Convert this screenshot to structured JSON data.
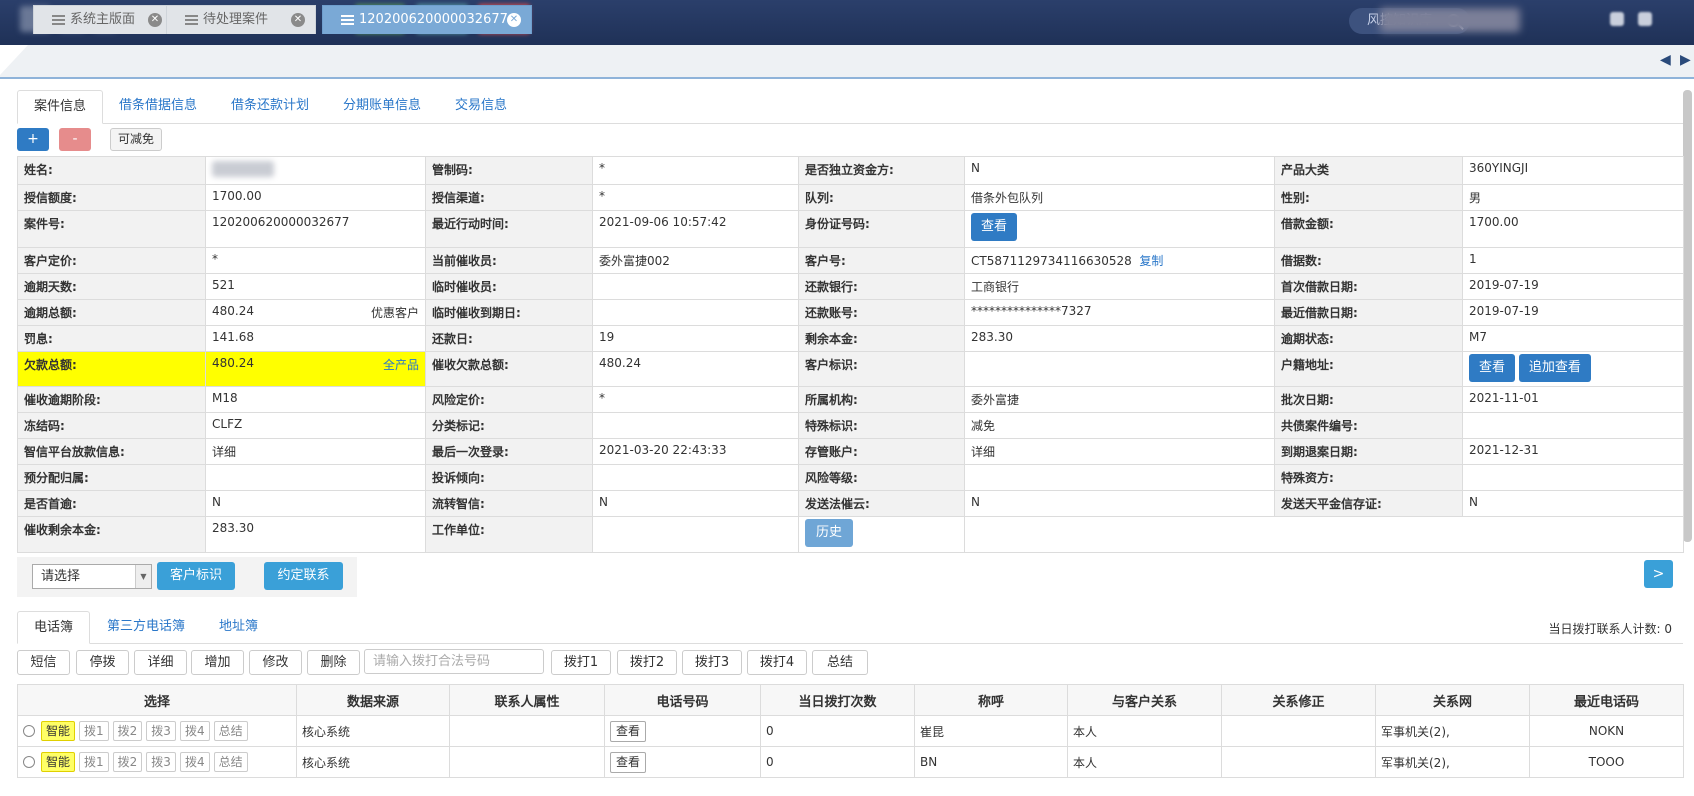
{
  "header": {
    "kb_search": "风控知识库"
  },
  "page_tabs": [
    {
      "label": "系统主版面"
    },
    {
      "label": "待处理案件"
    },
    {
      "label": "120200620000032677"
    }
  ],
  "subtabs": [
    "案件信息",
    "借条借据信息",
    "借条还款计划",
    "分期账单信息",
    "交易信息"
  ],
  "toolbar": {
    "plus": "+",
    "minus": "-",
    "relief": "可减免"
  },
  "info": {
    "name_lbl": "姓名:",
    "name_val": "",
    "ctrl_lbl": "管制码:",
    "ctrl_val": "*",
    "indep_lbl": "是否独立资金方:",
    "indep_val": "N",
    "prodcat_lbl": "产品大类",
    "prodcat_val": "360YINGJI",
    "credit_lbl": "授信额度:",
    "credit_val": "1700.00",
    "channel_lbl": "授信渠道:",
    "channel_val": "*",
    "queue_lbl": "队列:",
    "queue_val": "借条外包队列",
    "gender_lbl": "性别:",
    "gender_val": "男",
    "case_lbl": "案件号:",
    "case_val": "120200620000032677",
    "lastact_lbl": "最近行动时间:",
    "lastact_val": "2021-09-06 10:57:42",
    "idno_lbl": "身份证号码:",
    "idno_btn": "查看",
    "loanamt_lbl": "借款金额:",
    "loanamt_val": "1700.00",
    "price_lbl": "客户定价:",
    "price_val": "*",
    "collector_lbl": "当前催收员:",
    "collector_val": "委外富捷002",
    "custno_lbl": "客户号:",
    "custno_val": "CT5871129734116630528",
    "custno_copy": "复制",
    "notes_lbl": "借据数:",
    "notes_val": "1",
    "overdays_lbl": "逾期天数:",
    "overdays_val": "521",
    "tmpcol_lbl": "临时催收员:",
    "tmpcol_val": "",
    "bank_lbl": "还款银行:",
    "bank_val": "工商银行",
    "firstloan_lbl": "首次借款日期:",
    "firstloan_val": "2019-07-19",
    "overtotal_lbl": "逾期总额:",
    "overtotal_val": "480.24",
    "overtotal_tag": "优惠客户",
    "tmpdue_lbl": "临时催收到期日:",
    "tmpdue_val": "",
    "acct_lbl": "还款账号:",
    "acct_val": "***************7327",
    "lastloan_lbl": "最近借款日期:",
    "lastloan_val": "2019-07-19",
    "penalty_lbl": "罚息:",
    "penalty_val": "141.68",
    "payday_lbl": "还款日:",
    "payday_val": "19",
    "remain_lbl": "剩余本金:",
    "remain_val": "283.30",
    "overstat_lbl": "逾期状态:",
    "overstat_val": "M7",
    "owe_lbl": "欠款总额:",
    "owe_val": "480.24",
    "owe_tag": "全产品",
    "colowe_lbl": "催收欠款总额:",
    "colowe_val": "480.24",
    "custmark_lbl": "客户标识:",
    "custmark_val": "",
    "hukou_lbl": "户籍地址:",
    "hukou_btn1": "查看",
    "hukou_btn2": "追加查看",
    "stage_lbl": "催收逾期阶段:",
    "stage_val": "M18",
    "riskprice_lbl": "风险定价:",
    "riskprice_val": "*",
    "org_lbl": "所属机构:",
    "org_val": "委外富捷",
    "batch_lbl": "批次日期:",
    "batch_val": "2021-11-01",
    "freeze_lbl": "冻结码:",
    "freeze_val": "CLFZ",
    "class_lbl": "分类标记:",
    "class_val": "",
    "special_lbl": "特殊标识:",
    "special_val": "减免",
    "joint_lbl": "共债案件编号:",
    "joint_val": "",
    "zx_lbl": "智信平台放款信息:",
    "zx_val": "详细",
    "lastlogin_lbl": "最后一次登录:",
    "lastlogin_val": "2021-03-20 22:43:33",
    "deposit_lbl": "存管账户:",
    "deposit_val": "详细",
    "retreat_lbl": "到期退案日期:",
    "retreat_val": "2021-12-31",
    "prealloc_lbl": "预分配归属:",
    "prealloc_val": "",
    "complain_lbl": "投诉倾向:",
    "complain_val": "",
    "risklvl_lbl": "风险等级:",
    "risklvl_val": "",
    "specfund_lbl": "特殊资方:",
    "specfund_val": "",
    "firstover_lbl": "是否首逾:",
    "firstover_val": "N",
    "flow_lbl": "流转智信:",
    "flow_val": "N",
    "legal_lbl": "发送法催云:",
    "legal_val": "N",
    "tpj_lbl": "发送天平金信存证:",
    "tpj_val": "N",
    "colremain_lbl": "催收剩余本金:",
    "colremain_val": "283.30",
    "work_lbl": "工作单位:",
    "work_val": "",
    "history_btn": "历史"
  },
  "actions": {
    "select_placeholder": "请选择",
    "cust_mark_btn": "客户标识",
    "appoint_btn": "约定联系",
    "next_btn": ">"
  },
  "phone_tabs": [
    "电话簿",
    "第三方电话簿",
    "地址簿"
  ],
  "dial_count": "当日拨打联系人计数: 0",
  "phone_toolbar": {
    "sms": "短信",
    "stop": "停拨",
    "detail": "详细",
    "add": "增加",
    "edit": "修改",
    "delete": "删除",
    "dial_placeholder": "请输入拨打合法号码",
    "dial1": "拨打1",
    "dial2": "拨打2",
    "dial3": "拨打3",
    "dial4": "拨打4",
    "summary": "总结"
  },
  "phone_table": {
    "headers": [
      "选择",
      "数据来源",
      "联系人属性",
      "电话号码",
      "当日拨打次数",
      "称呼",
      "与客户关系",
      "关系修正",
      "关系网",
      "最近电话码"
    ],
    "row_btns": {
      "smart": "智能",
      "b1": "拨1",
      "b2": "拨2",
      "b3": "拨3",
      "b4": "拨4",
      "sum": "总结",
      "view": "查看"
    },
    "rows": [
      {
        "source": "核心系统",
        "attr": "",
        "calls": "0",
        "title": "崔昆",
        "relation": "本人",
        "fix": "",
        "net": "军事机关(2),",
        "last": "NOKN"
      },
      {
        "source": "核心系统",
        "attr": "",
        "calls": "0",
        "title": "BN",
        "relation": "本人",
        "fix": "",
        "net": "军事机关(2),",
        "last": "TOOO"
      }
    ]
  }
}
